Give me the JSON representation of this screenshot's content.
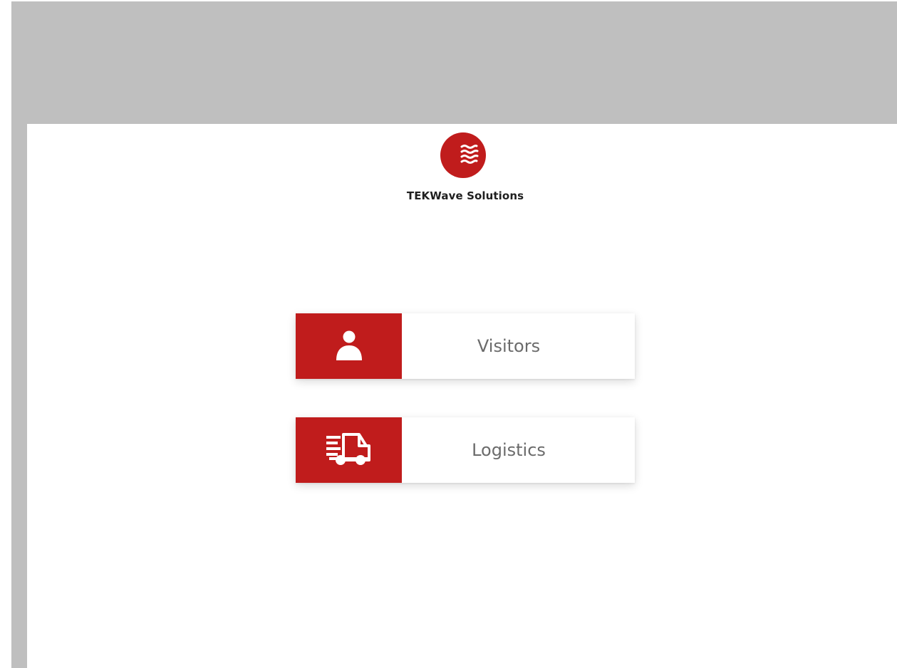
{
  "brand": {
    "name": "TEKWave Solutions",
    "logo_icon": "wave-circle-icon",
    "accent_color": "#c01c1c"
  },
  "menu": [
    {
      "label": "Visitors",
      "icon": "person-icon"
    },
    {
      "label": "Logistics",
      "icon": "delivery-truck-icon"
    }
  ],
  "colors": {
    "frame_gray": "#bfbfbf",
    "label_gray": "#6b6b6b"
  }
}
